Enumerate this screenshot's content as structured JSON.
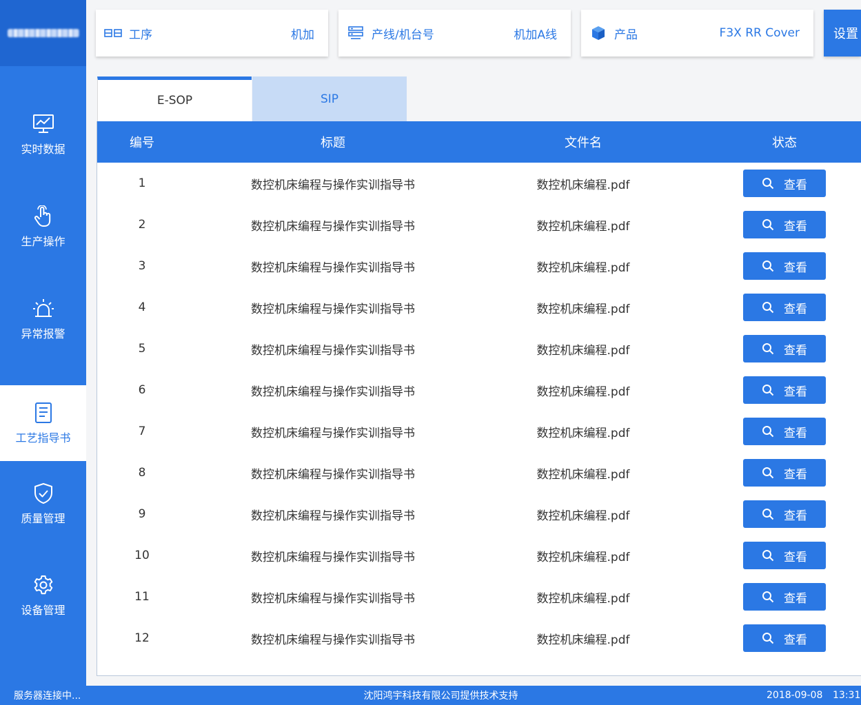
{
  "sidebar": {
    "items": [
      {
        "label": "实时数据",
        "icon": "monitor-chart-icon",
        "active": false
      },
      {
        "label": "生产操作",
        "icon": "hand-pointer-icon",
        "active": false
      },
      {
        "label": "异常报警",
        "icon": "alarm-light-icon",
        "active": false
      },
      {
        "label": "工艺指导书",
        "icon": "document-icon",
        "active": true
      },
      {
        "label": "质量管理",
        "icon": "shield-check-icon",
        "active": false
      },
      {
        "label": "设备管理",
        "icon": "gear-icon",
        "active": false
      }
    ]
  },
  "header": {
    "process": {
      "label": "工序",
      "value": "机加",
      "icon": "process-icon"
    },
    "line": {
      "label": "产线/机台号",
      "value": "机加A线",
      "icon": "server-icon"
    },
    "product": {
      "label": "产品",
      "value": "F3X RR Cover",
      "icon": "cube-icon"
    },
    "settings_label": "设置"
  },
  "tabs": [
    {
      "label": "E-SOP",
      "active": true
    },
    {
      "label": "SIP",
      "active": false
    }
  ],
  "table": {
    "columns": [
      "编号",
      "标题",
      "文件名",
      "状态"
    ],
    "view_label": "查看",
    "rows": [
      {
        "num": "1",
        "title": "数控机床编程与操作实训指导书",
        "file": "数控机床编程.pdf"
      },
      {
        "num": "2",
        "title": "数控机床编程与操作实训指导书",
        "file": "数控机床编程.pdf"
      },
      {
        "num": "3",
        "title": "数控机床编程与操作实训指导书",
        "file": "数控机床编程.pdf"
      },
      {
        "num": "4",
        "title": "数控机床编程与操作实训指导书",
        "file": "数控机床编程.pdf"
      },
      {
        "num": "5",
        "title": "数控机床编程与操作实训指导书",
        "file": "数控机床编程.pdf"
      },
      {
        "num": "6",
        "title": "数控机床编程与操作实训指导书",
        "file": "数控机床编程.pdf"
      },
      {
        "num": "7",
        "title": "数控机床编程与操作实训指导书",
        "file": "数控机床编程.pdf"
      },
      {
        "num": "8",
        "title": "数控机床编程与操作实训指导书",
        "file": "数控机床编程.pdf"
      },
      {
        "num": "9",
        "title": "数控机床编程与操作实训指导书",
        "file": "数控机床编程.pdf"
      },
      {
        "num": "10",
        "title": "数控机床编程与操作实训指导书",
        "file": "数控机床编程.pdf"
      },
      {
        "num": "11",
        "title": "数控机床编程与操作实训指导书",
        "file": "数控机床编程.pdf"
      },
      {
        "num": "12",
        "title": "数控机床编程与操作实训指导书",
        "file": "数控机床编程.pdf"
      }
    ]
  },
  "statusbar": {
    "connection": "服务器连接中...",
    "support": "沈阳鸿宇科技有限公司提供技术支持",
    "date": "2018-09-08",
    "time": "13:31:"
  },
  "colors": {
    "primary": "#2b78e4",
    "sidebar_dark": "#1f66d1",
    "tab_inactive": "#c7dbf6"
  }
}
